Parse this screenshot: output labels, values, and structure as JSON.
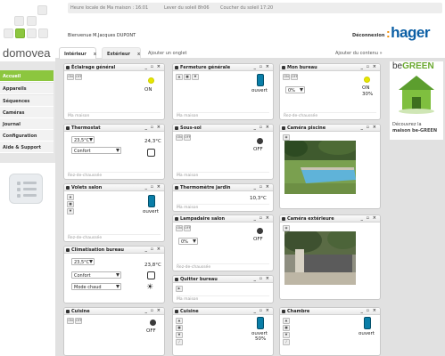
{
  "header": {
    "local_time": "Heure locale de Ma maison : 16:01",
    "sunrise": "Lever du soleil 8h06",
    "sunset": "Coucher du soleil 17:20",
    "welcome": "Bienvenue M.Jacques DUPONT",
    "logout": "Déconnexion",
    "hager": "hager"
  },
  "logo": "domovea",
  "sidebar": {
    "items": [
      {
        "label": "Accueil",
        "active": true
      },
      {
        "label": "Appareils",
        "active": false
      },
      {
        "label": "Séquences",
        "active": false
      },
      {
        "label": "Caméras",
        "active": false
      },
      {
        "label": "Journal",
        "active": false
      },
      {
        "label": "Configuration",
        "active": false
      },
      {
        "label": "Aide & Support",
        "active": false
      }
    ]
  },
  "tabs": {
    "items": [
      {
        "label": "Intérieur",
        "active": true,
        "close": "x"
      },
      {
        "label": "Extérieur",
        "active": false,
        "close": "x"
      }
    ],
    "add_tab": "Ajouter un onglet",
    "add_content": "Ajouter du contenu »"
  },
  "widgets": {
    "eclairage": {
      "title": "Éclairage général",
      "btn_on": "ON",
      "btn_off": "OFF",
      "state": "ON",
      "footer": "Ma maison"
    },
    "fermeture": {
      "title": "Fermeture générale",
      "state": "ouvert",
      "footer": "Ma maison"
    },
    "monbureau": {
      "title": "Mon bureau",
      "select": "0%",
      "state": "ON",
      "percent": "30%",
      "footer": "Rez-de-chaussée"
    },
    "thermostat": {
      "title": "Thermostat",
      "setpoint": "23,5°C",
      "mode": "Confort",
      "temp": "24,3°C",
      "footer": "Rez-de-chaussée"
    },
    "soussol": {
      "title": "Sous-sol",
      "btn_on": "ON",
      "btn_off": "OFF",
      "state": "OFF",
      "footer": "Ma maison"
    },
    "camera_piscine": {
      "title": "Caméra piscine"
    },
    "volets_salon": {
      "title": "Volets salon",
      "state": "ouvert",
      "footer": "Rez-de-chaussée"
    },
    "thermometre": {
      "title": "Thermomètre jardin",
      "temp": "10,3°C",
      "footer": "Ma maison"
    },
    "camera_ext": {
      "title": "Caméra extérieure"
    },
    "lampadaire": {
      "title": "Lampadaire salon",
      "btn_on": "ON",
      "btn_off": "OFF",
      "select": "0%",
      "state": "OFF",
      "footer": "Rez-de-chaussée"
    },
    "clim": {
      "title": "Climatisation bureau",
      "setpoint": "23,5°C",
      "mode1": "Confort",
      "mode2": "Mode chaud",
      "temp": "23,8°C",
      "footer": "Rez-de-chaussée"
    },
    "quitter": {
      "title": "Quitter bureau",
      "footer": "Ma maison"
    },
    "cuisine1": {
      "title": "Cuisine",
      "btn_on": "ON",
      "btn_off": "OFF",
      "state": "OFF"
    },
    "cuisine2": {
      "title": "Cuisine",
      "state": "ouvert",
      "percent": "50%"
    },
    "chambre": {
      "title": "Chambre",
      "state": "ouvert"
    }
  },
  "ad": {
    "brand_prefix": "be",
    "brand": "GREEN",
    "line1": "Découvrez la",
    "line2": "maison be-GREEN"
  },
  "colors": {
    "accent": "#8cc63f",
    "hager_blue": "#0b5fa5",
    "shutter": "#0a7ea8",
    "bulb_on": "#e6e600"
  }
}
